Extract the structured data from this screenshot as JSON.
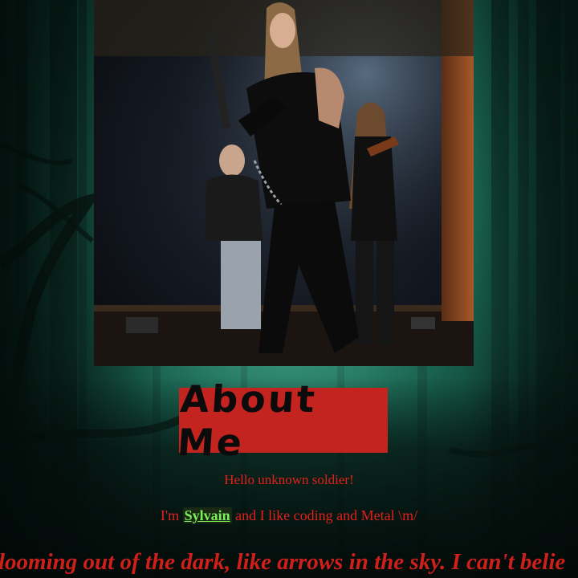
{
  "photo": {
    "alt": "Band on stage"
  },
  "about": {
    "title": "About Me"
  },
  "greeting": "Hello unknown soldier!",
  "intro": {
    "prefix": "I'm ",
    "name": "Sylvain",
    "suffix": " and I like coding and Metal \\m/"
  },
  "lyrics": "looming out of the dark, like arrows in the sky. I can't belie",
  "colors": {
    "accent_red": "#e3201a",
    "heading_box": "#c4241f",
    "name_green": "#7cf05a"
  }
}
